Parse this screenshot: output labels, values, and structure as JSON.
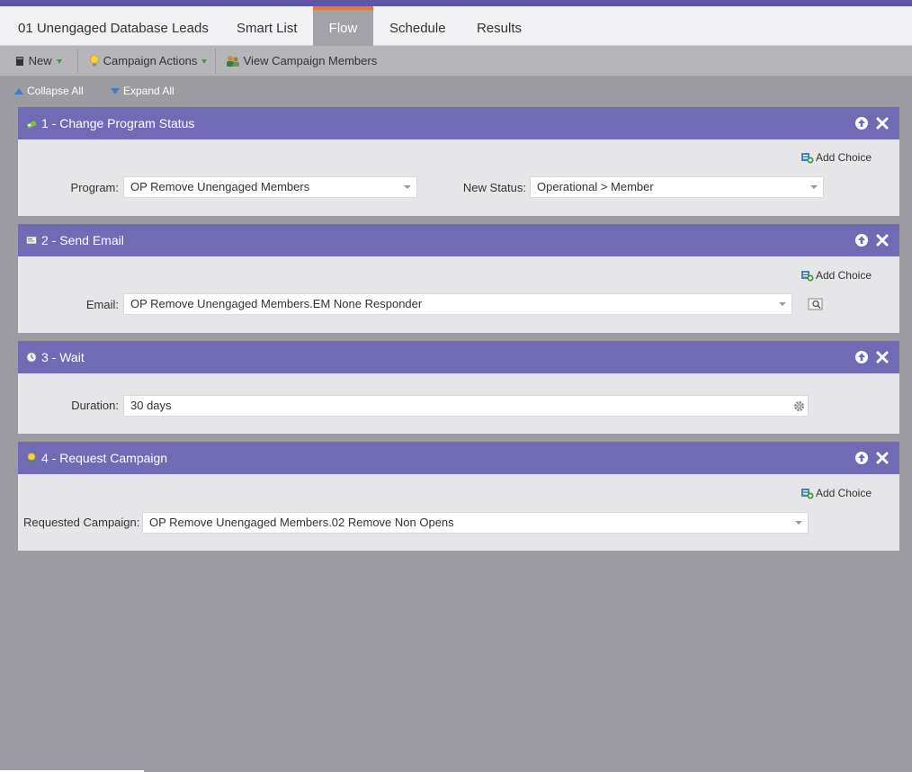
{
  "tabs": [
    {
      "label": "01 Unengaged Database Leads",
      "active": false
    },
    {
      "label": "Smart List",
      "active": false
    },
    {
      "label": "Flow",
      "active": true
    },
    {
      "label": "Schedule",
      "active": false
    },
    {
      "label": "Results",
      "active": false
    }
  ],
  "toolbar": {
    "new_label": "New",
    "campaign_actions_label": "Campaign Actions",
    "view_members_label": "View Campaign Members"
  },
  "expanders": {
    "collapse_label": "Collapse All",
    "expand_label": "Expand All"
  },
  "steps": [
    {
      "title": "1 - Change Program Status",
      "icon": "status-icon",
      "add_choice": "Add Choice",
      "program_label": "Program:",
      "program_value": "OP Remove Unengaged Members",
      "status_label": "New Status:",
      "status_value": "Operational > Member"
    },
    {
      "title": "2 - Send Email",
      "icon": "email-icon",
      "add_choice": "Add Choice",
      "email_label": "Email:",
      "email_value": "OP Remove Unengaged Members.EM None Responder"
    },
    {
      "title": "3 - Wait",
      "icon": "clock-icon",
      "duration_label": "Duration:",
      "duration_value": "30 days"
    },
    {
      "title": "4 - Request Campaign",
      "icon": "lightbulb-icon",
      "add_choice": "Add Choice",
      "campaign_label": "Requested Campaign:",
      "campaign_value": "OP Remove Unengaged Members.02 Remove Non Opens"
    }
  ],
  "colors": {
    "accent_top": "#5f55a6",
    "step_header": "#716bb5",
    "active_tab": "#a2a2a8",
    "active_tab_border": "#e8773a",
    "canvas": "#9b9ba1"
  }
}
